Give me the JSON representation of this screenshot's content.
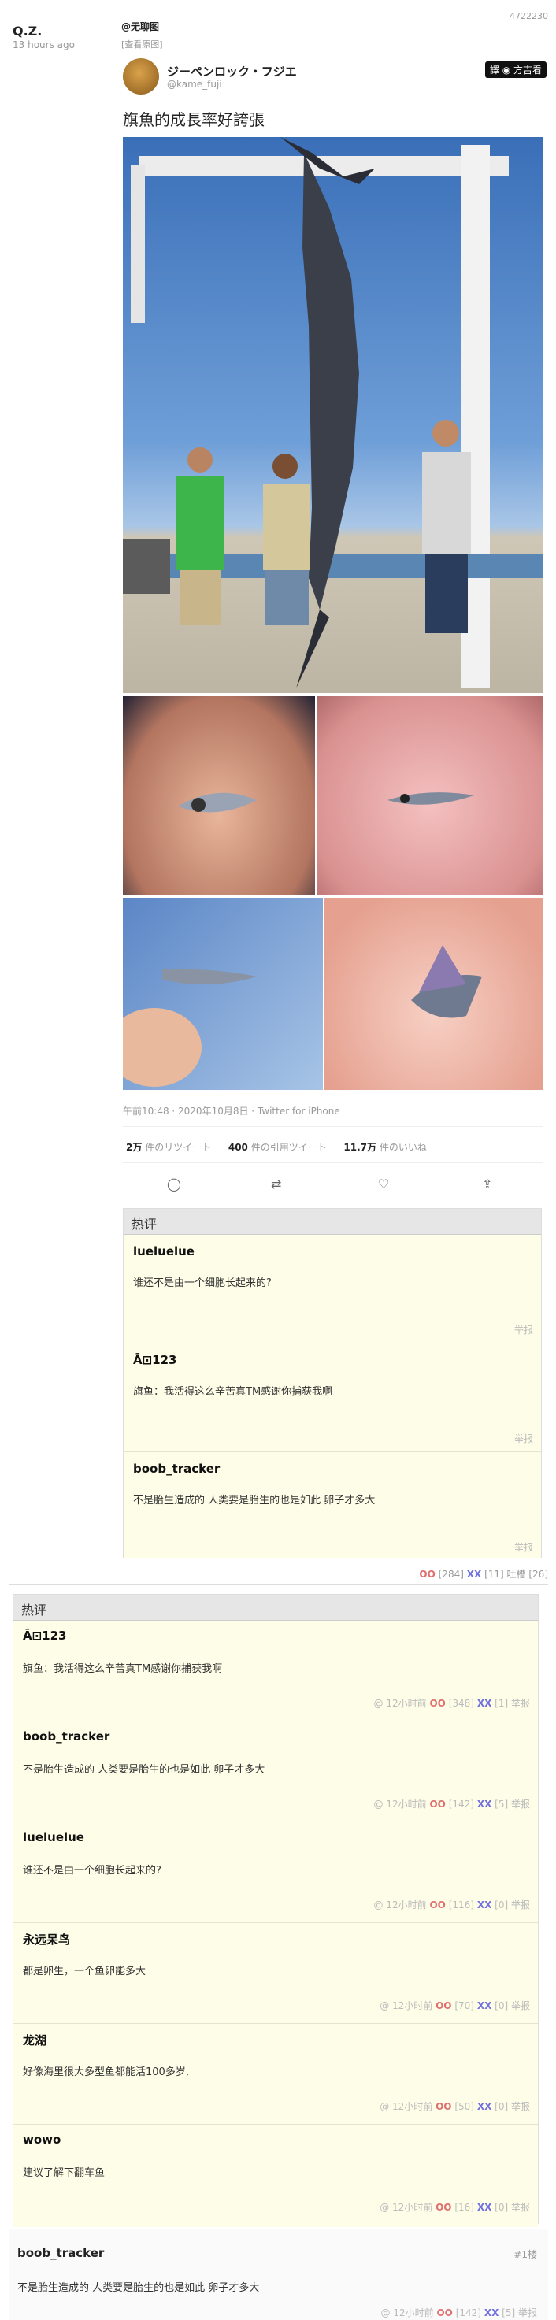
{
  "post": {
    "id": "4722230",
    "author": "Q.Z.",
    "time": "13 hours ago",
    "tags": "@无聊图",
    "view_original": "[查看原图]"
  },
  "tweet": {
    "display_name": "ジーペンロック・フジエ",
    "handle": "@kame_fuji",
    "lang_button": "譯 ◉ 方吉看",
    "text": "旗魚的成長率好誇張",
    "timestamp": "午前10:48 · 2020年10月8日 · Twitter for iPhone",
    "retweets_num": "2万",
    "retweets_label": "件のリツイート",
    "quotes_num": "400",
    "quotes_label": "件の引用ツイート",
    "likes_num": "11.7万",
    "likes_label": "件のいいね",
    "icons": [
      "reply-icon",
      "retweet-icon",
      "like-icon",
      "share-icon"
    ]
  },
  "images": [
    {
      "name": "photo-marlin-hanging"
    },
    {
      "name": "photo-baby-fish-1"
    },
    {
      "name": "photo-baby-fish-2"
    },
    {
      "name": "photo-baby-fish-3"
    },
    {
      "name": "photo-baby-fish-4"
    }
  ],
  "inner_hot": {
    "title": "热评",
    "comments": [
      {
        "name": "lueluelue",
        "text": "谁还不是由一个细胞长起来的?",
        "report": "举报"
      },
      {
        "name": "Ā⊡123",
        "text": "旗鱼：我活得这么辛苦真TM感谢你捕获我啊",
        "report": "举报"
      },
      {
        "name": "boob_tracker",
        "text": "不是胎生造成的 人类要是胎生的也是如此 卵子才多大",
        "report": "举报"
      }
    ]
  },
  "post_votes": {
    "oo": "OO",
    "oo_count": "[284]",
    "xx": "XX",
    "xx_count": "[11]",
    "tucao": "吐槽 [26]"
  },
  "hot": {
    "title": "热评",
    "comments": [
      {
        "name": "Ā⊡123",
        "text": "旗鱼：我活得这么辛苦真TM感谢你捕获我啊",
        "time": "@ 12小时前",
        "oo": "OO",
        "oo_count": "[348]",
        "xx": "XX",
        "xx_count": "[1]",
        "report": "举报"
      },
      {
        "name": "boob_tracker",
        "text": "不是胎生造成的 人类要是胎生的也是如此 卵子才多大",
        "time": "@ 12小时前",
        "oo": "OO",
        "oo_count": "[142]",
        "xx": "XX",
        "xx_count": "[5]",
        "report": "举报"
      },
      {
        "name": "lueluelue",
        "text": "谁还不是由一个细胞长起来的?",
        "time": "@ 12小时前",
        "oo": "OO",
        "oo_count": "[116]",
        "xx": "XX",
        "xx_count": "[0]",
        "report": "举报"
      },
      {
        "name": "永远呆鸟",
        "text": "都是卵生，一个鱼卵能多大",
        "time": "@ 12小时前",
        "oo": "OO",
        "oo_count": "[70]",
        "xx": "XX",
        "xx_count": "[0]",
        "report": "举报"
      },
      {
        "name": "龙湖",
        "text": "好像海里很大多型鱼都能活100多岁,",
        "time": "@ 12小时前",
        "oo": "OO",
        "oo_count": "[50]",
        "xx": "XX",
        "xx_count": "[0]",
        "report": "举报"
      },
      {
        "name": "wowo",
        "text": "建议了解下翻车鱼",
        "time": "@ 12小时前",
        "oo": "OO",
        "oo_count": "[16]",
        "xx": "XX",
        "xx_count": "[0]",
        "report": "举报"
      }
    ]
  },
  "bottom_comment": {
    "name": "boob_tracker",
    "floor": "#1楼",
    "text": "不是胎生造成的 人类要是胎生的也是如此 卵子才多大",
    "time": "@ 12小时前",
    "oo": "OO",
    "oo_count": "[142]",
    "xx": "XX",
    "xx_count": "[5]",
    "report": "举报"
  }
}
